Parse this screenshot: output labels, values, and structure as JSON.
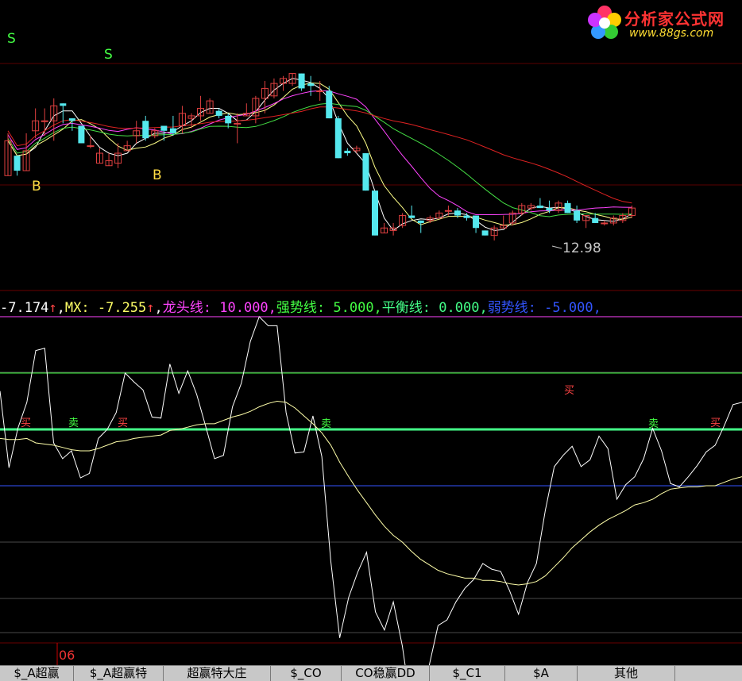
{
  "logo": {
    "title": "分析家公式网",
    "url_text": "www.88gs.com",
    "colors": {
      "title": "#ff3333",
      "url": "#ffdd33"
    }
  },
  "indicator_line": {
    "v1": "-7.174",
    "mx": "MX: -7.255",
    "dragon": "龙头线: 10.000,",
    "strong": "强势线: 5.000,",
    "balance": "平衡线: 0.000,",
    "weak": "弱势线: -5.000,",
    "colors": {
      "v1": "#ffffff",
      "mx": "#ffff66",
      "dragon": "#ff44ff",
      "strong": "#44ff44",
      "balance": "#44ff88",
      "weak": "#3355ff"
    }
  },
  "date_label": "06",
  "tabs": [
    {
      "label": "$_A超赢"
    },
    {
      "label": "$_A超赢特"
    },
    {
      "label": "超赢特大庄"
    },
    {
      "label": "$_CO"
    },
    {
      "label": "CO稳赢DD"
    },
    {
      "label": "$_C1"
    },
    {
      "label": "$A"
    },
    {
      "label": "其他"
    }
  ],
  "chart_data": [
    {
      "type": "candlestick",
      "price_label": "12.98",
      "markers": [
        {
          "text": "S",
          "color": "#44ff44"
        },
        {
          "text": "S",
          "color": "#44ff44"
        },
        {
          "text": "B",
          "color": "#ffdd44"
        },
        {
          "text": "B",
          "color": "#ffdd44"
        }
      ],
      "ma_colors": [
        "#ffffff",
        "#ffff88",
        "#ff44ff",
        "#44dd44",
        "#dd2222"
      ],
      "candles": [
        {
          "o": 11.9,
          "h": 13.6,
          "l": 12.5,
          "c": 13.3
        },
        {
          "o": 12.7,
          "h": 12.6,
          "l": 11.9,
          "c": 12.1
        },
        {
          "o": 12.1,
          "h": 13.6,
          "l": 12.4,
          "c": 12.9
        },
        {
          "o": 13.7,
          "h": 14.6,
          "l": 13.4,
          "c": 14.1
        },
        {
          "o": 14.1,
          "h": 14.6,
          "l": 13.5,
          "c": 14.1
        },
        {
          "o": 14.1,
          "h": 15.0,
          "l": 13.3,
          "c": 14.7
        },
        {
          "o": 14.8,
          "h": 14.7,
          "l": 14.0,
          "c": 14.7
        },
        {
          "o": 14.2,
          "h": 14.2,
          "l": 13.7,
          "c": 14.1
        },
        {
          "o": 13.9,
          "h": 13.8,
          "l": 13.2,
          "c": 13.2
        },
        {
          "o": 13.1,
          "h": 13.5,
          "l": 13.0,
          "c": 13.1
        },
        {
          "o": 12.4,
          "h": 13.0,
          "l": 12.4,
          "c": 12.8
        },
        {
          "o": 12.3,
          "h": 12.8,
          "l": 12.3,
          "c": 12.5
        },
        {
          "o": 12.4,
          "h": 13.2,
          "l": 12.2,
          "c": 12.8
        },
        {
          "o": 12.9,
          "h": 13.3,
          "l": 13.0,
          "c": 13.1
        },
        {
          "o": 13.5,
          "h": 14.1,
          "l": 13.2,
          "c": 13.7
        },
        {
          "o": 14.1,
          "h": 14.3,
          "l": 13.3,
          "c": 13.4
        },
        {
          "o": 13.5,
          "h": 13.8,
          "l": 13.4,
          "c": 13.7
        },
        {
          "o": 13.9,
          "h": 13.7,
          "l": 13.3,
          "c": 13.7
        },
        {
          "o": 13.8,
          "h": 14.3,
          "l": 13.5,
          "c": 13.6
        },
        {
          "o": 13.9,
          "h": 14.7,
          "l": 13.6,
          "c": 14.4
        },
        {
          "o": 14.2,
          "h": 14.4,
          "l": 13.8,
          "c": 14.3
        },
        {
          "o": 14.3,
          "h": 15.1,
          "l": 14.1,
          "c": 14.6
        },
        {
          "o": 14.4,
          "h": 15.0,
          "l": 14.5,
          "c": 14.9
        },
        {
          "o": 14.5,
          "h": 14.6,
          "l": 14.2,
          "c": 14.3
        },
        {
          "o": 14.3,
          "h": 14.4,
          "l": 13.8,
          "c": 14.0
        },
        {
          "o": 14.0,
          "h": 14.4,
          "l": 13.2,
          "c": 14.0
        },
        {
          "o": 14.3,
          "h": 14.8,
          "l": 14.3,
          "c": 14.4
        },
        {
          "o": 14.3,
          "h": 15.1,
          "l": 14.0,
          "c": 15.0
        },
        {
          "o": 15.0,
          "h": 15.7,
          "l": 14.4,
          "c": 15.4
        },
        {
          "o": 15.1,
          "h": 15.8,
          "l": 15.0,
          "c": 15.6
        },
        {
          "o": 15.6,
          "h": 15.9,
          "l": 15.3,
          "c": 15.8
        },
        {
          "o": 15.6,
          "h": 16.0,
          "l": 15.5,
          "c": 16.0
        },
        {
          "o": 16.0,
          "h": 16.0,
          "l": 15.3,
          "c": 15.4
        },
        {
          "o": 15.6,
          "h": 15.9,
          "l": 15.1,
          "c": 15.5
        },
        {
          "o": 15.3,
          "h": 15.7,
          "l": 14.9,
          "c": 15.3
        },
        {
          "o": 15.3,
          "h": 15.5,
          "l": 14.4,
          "c": 14.2
        },
        {
          "o": 14.2,
          "h": 14.3,
          "l": 12.9,
          "c": 12.6
        },
        {
          "o": 12.9,
          "h": 13.0,
          "l": 12.7,
          "c": 12.8
        },
        {
          "o": 12.9,
          "h": 13.1,
          "l": 12.8,
          "c": 13.0
        },
        {
          "o": 12.8,
          "h": 12.7,
          "l": 11.5,
          "c": 11.3
        },
        {
          "o": 11.3,
          "h": 11.1,
          "l": 9.6,
          "c": 9.5
        },
        {
          "o": 9.6,
          "h": 10.0,
          "l": 9.7,
          "c": 9.8
        },
        {
          "o": 9.7,
          "h": 10.0,
          "l": 9.5,
          "c": 9.8
        },
        {
          "o": 9.9,
          "h": 10.4,
          "l": 9.8,
          "c": 10.3
        },
        {
          "o": 10.3,
          "h": 10.7,
          "l": 10.2,
          "c": 10.2
        },
        {
          "o": 10.1,
          "h": 10.1,
          "l": 9.6,
          "c": 10.0
        },
        {
          "o": 10.1,
          "h": 10.3,
          "l": 10.0,
          "c": 10.2
        },
        {
          "o": 10.2,
          "h": 10.5,
          "l": 10.2,
          "c": 10.4
        },
        {
          "o": 10.5,
          "h": 10.7,
          "l": 10.3,
          "c": 10.5
        },
        {
          "o": 10.5,
          "h": 10.6,
          "l": 10.2,
          "c": 10.3
        },
        {
          "o": 10.3,
          "h": 10.4,
          "l": 10.1,
          "c": 10.2
        },
        {
          "o": 10.3,
          "h": 10.3,
          "l": 9.6,
          "c": 9.8
        },
        {
          "o": 9.7,
          "h": 9.6,
          "l": 9.5,
          "c": 9.5
        },
        {
          "o": 9.5,
          "h": 9.9,
          "l": 9.3,
          "c": 9.8
        },
        {
          "o": 9.8,
          "h": 10.3,
          "l": 9.8,
          "c": 9.9
        },
        {
          "o": 10.0,
          "h": 10.5,
          "l": 9.9,
          "c": 10.4
        },
        {
          "o": 10.4,
          "h": 10.8,
          "l": 10.3,
          "c": 10.7
        },
        {
          "o": 10.6,
          "h": 10.8,
          "l": 10.5,
          "c": 10.7
        },
        {
          "o": 10.7,
          "h": 11.0,
          "l": 10.6,
          "c": 10.6
        },
        {
          "o": 10.6,
          "h": 10.9,
          "l": 10.4,
          "c": 10.5
        },
        {
          "o": 10.5,
          "h": 10.9,
          "l": 10.4,
          "c": 10.8
        },
        {
          "o": 10.8,
          "h": 10.9,
          "l": 10.5,
          "c": 10.4
        },
        {
          "o": 10.5,
          "h": 10.7,
          "l": 10.0,
          "c": 10.1
        },
        {
          "o": 10.1,
          "h": 10.3,
          "l": 9.8,
          "c": 10.3
        },
        {
          "o": 10.2,
          "h": 10.4,
          "l": 10.0,
          "c": 10.0
        },
        {
          "o": 10.0,
          "h": 10.1,
          "l": 9.9,
          "c": 10.0
        },
        {
          "o": 10.0,
          "h": 10.3,
          "l": 9.9,
          "c": 10.2
        },
        {
          "o": 10.1,
          "h": 10.4,
          "l": 10.0,
          "c": 10.3
        },
        {
          "o": 10.3,
          "h": 10.7,
          "l": 10.2,
          "c": 10.6
        }
      ]
    },
    {
      "type": "line",
      "series": [
        {
          "values": [
            3.4,
            -3.4,
            0.1,
            2.4,
            7.0,
            7.2,
            -1.2,
            -2.6,
            -1.9,
            -4.3,
            -3.9,
            -0.8,
            0.0,
            1.5,
            5.0,
            4.2,
            3.5,
            1.1,
            1.0,
            5.8,
            3.2,
            5.2,
            3.1,
            0.3,
            -2.6,
            -2.3,
            2.0,
            4.1,
            7.8,
            10.0,
            9.2,
            9.2,
            1.5,
            -2.1,
            -2.0,
            1.2,
            -2.4,
            -11.7,
            -18.5,
            -14.9,
            -12.7,
            -10.9,
            -16.2,
            -17.8,
            -15.3,
            -19.2,
            -24.6,
            -22.2,
            -21.0,
            -17.4,
            -16.9,
            -15.3,
            -14.1,
            -13.3,
            -11.9,
            -12.4,
            -12.6,
            -14.3,
            -16.4,
            -13.6,
            -11.9,
            -7.2,
            -3.3,
            -2.3,
            -1.5,
            -3.3,
            -2.7,
            -0.6,
            -1.7,
            -6.2,
            -4.9,
            -4.2,
            -2.6,
            0.1,
            -1.9,
            -4.8,
            -5.1,
            -4.2,
            -3.2,
            -2.0,
            -1.4,
            0.3,
            2.2,
            2.4
          ]
        },
        {
          "values": [
            -0.8,
            -0.9,
            -0.9,
            -0.8,
            -1.2,
            -1.3,
            -1.4,
            -1.6,
            -1.8,
            -1.9,
            -1.9,
            -1.7,
            -1.4,
            -1.1,
            -1.0,
            -0.8,
            -0.7,
            -0.6,
            -0.5,
            -0.1,
            0.0,
            0.2,
            0.4,
            0.5,
            0.5,
            0.8,
            1.1,
            1.3,
            1.6,
            2.0,
            2.3,
            2.5,
            2.4,
            1.9,
            1.2,
            0.5,
            -0.3,
            -1.4,
            -2.9,
            -4.2,
            -5.4,
            -6.5,
            -7.6,
            -8.6,
            -9.4,
            -10.0,
            -10.8,
            -11.5,
            -12.0,
            -12.5,
            -12.8,
            -13.0,
            -13.2,
            -13.2,
            -13.4,
            -13.4,
            -13.5,
            -13.7,
            -13.8,
            -13.7,
            -13.5,
            -13.0,
            -12.2,
            -11.4,
            -10.5,
            -9.8,
            -9.1,
            -8.5,
            -8.0,
            -7.6,
            -7.2,
            -6.7,
            -6.5,
            -6.2,
            -5.7,
            -5.3,
            -5.2,
            -5.1,
            -5.1,
            -5.0,
            -5.0,
            -4.7,
            -4.4,
            -4.2
          ]
        }
      ],
      "reference_lines": [
        {
          "name": "龙头线",
          "value": 10.0,
          "color": "#ff44ff"
        },
        {
          "name": "强势线",
          "value": 5.0,
          "color": "#44ff44"
        },
        {
          "name": "平衡线",
          "value": 0.0,
          "color": "#44ff88"
        },
        {
          "name": "弱势线",
          "value": -5.0,
          "color": "#3355ff"
        }
      ],
      "signal_labels": [
        {
          "text": "买",
          "color": "#ff4444"
        },
        {
          "text": "卖",
          "color": "#44ff44"
        },
        {
          "text": "买",
          "color": "#ff4444"
        },
        {
          "text": "卖",
          "color": "#44ff44"
        },
        {
          "text": "买",
          "color": "#ff4444"
        },
        {
          "text": "卖",
          "color": "#44ff44"
        },
        {
          "text": "买",
          "color": "#ff4444"
        }
      ]
    }
  ]
}
